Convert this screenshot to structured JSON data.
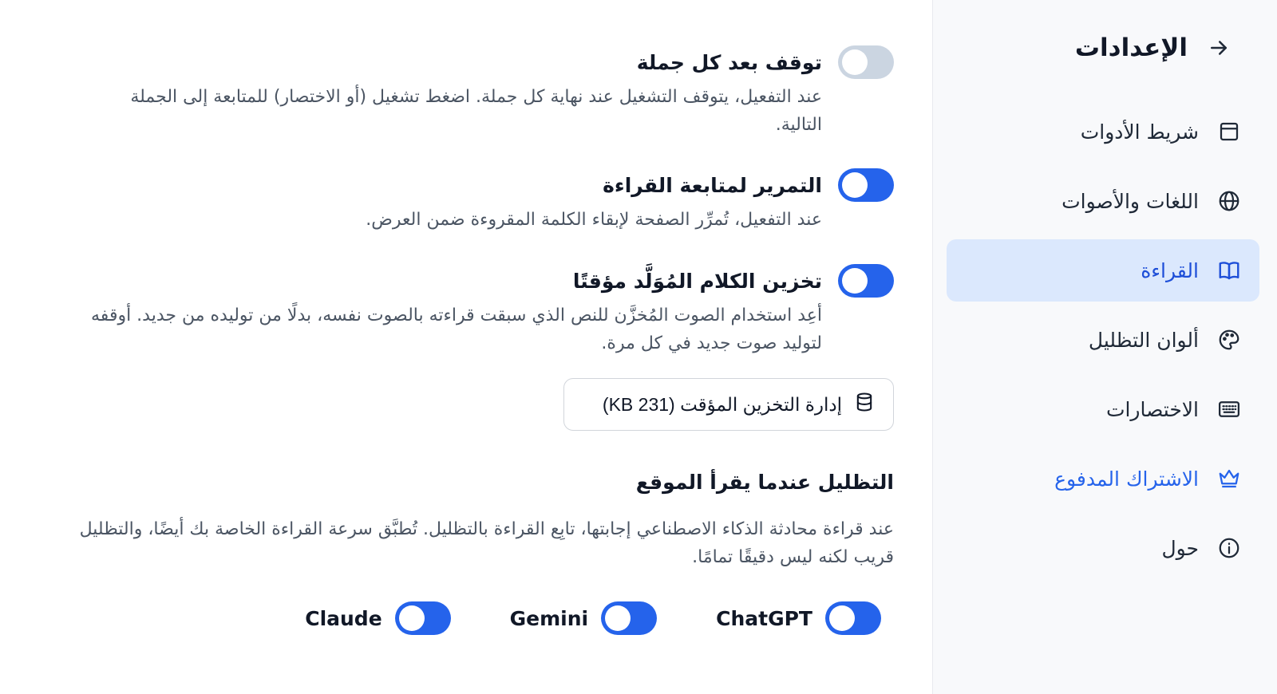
{
  "sidebar": {
    "title": "الإعدادات",
    "items": [
      {
        "label": "شريط الأدوات",
        "icon": "toolbar-icon"
      },
      {
        "label": "اللغات والأصوات",
        "icon": "globe-icon"
      },
      {
        "label": "القراءة",
        "icon": "book-icon",
        "active": true
      },
      {
        "label": "ألوان التظليل",
        "icon": "palette-icon"
      },
      {
        "label": "الاختصارات",
        "icon": "keyboard-icon"
      },
      {
        "label": "الاشتراك المدفوع",
        "icon": "crown-icon"
      },
      {
        "label": "حول",
        "icon": "info-icon"
      }
    ]
  },
  "settings": {
    "pause_sentence": {
      "title": "توقف بعد كل جملة",
      "desc": "عند التفعيل، يتوقف التشغيل عند نهاية كل جملة. اضغط تشغيل (أو الاختصار) للمتابعة إلى الجملة التالية.",
      "enabled": false
    },
    "scroll_follow": {
      "title": "التمرير لمتابعة القراءة",
      "desc": "عند التفعيل، تُمرِّر الصفحة لإبقاء الكلمة المقروءة ضمن العرض.",
      "enabled": true
    },
    "cache_speech": {
      "title": "تخزين الكلام المُوَلَّد مؤقتًا",
      "desc": "أعِد استخدام الصوت المُخزَّن للنص الذي سبقت قراءته بالصوت نفسه، بدلًا من توليده من جديد. أوقفه لتوليد صوت جديد في كل مرة.",
      "enabled": true
    },
    "cache_button": "إدارة التخزين المؤقت (231 KB)"
  },
  "highlight": {
    "title": "التظليل عندما يقرأ الموقع",
    "desc": "عند قراءة محادثة الذكاء الاصطناعي إجابتها، تابِع القراءة بالتظليل. تُطبَّق سرعة القراءة الخاصة بك أيضًا، والتظليل قريب لكنه ليس دقيقًا تمامًا.",
    "models": [
      {
        "name": "ChatGPT",
        "enabled": true
      },
      {
        "name": "Gemini",
        "enabled": true
      },
      {
        "name": "Claude",
        "enabled": true
      }
    ]
  },
  "colors": {
    "accent": "#2563eb",
    "active_bg": "#dbe8fd",
    "toggle_off": "#cbd5e1"
  }
}
